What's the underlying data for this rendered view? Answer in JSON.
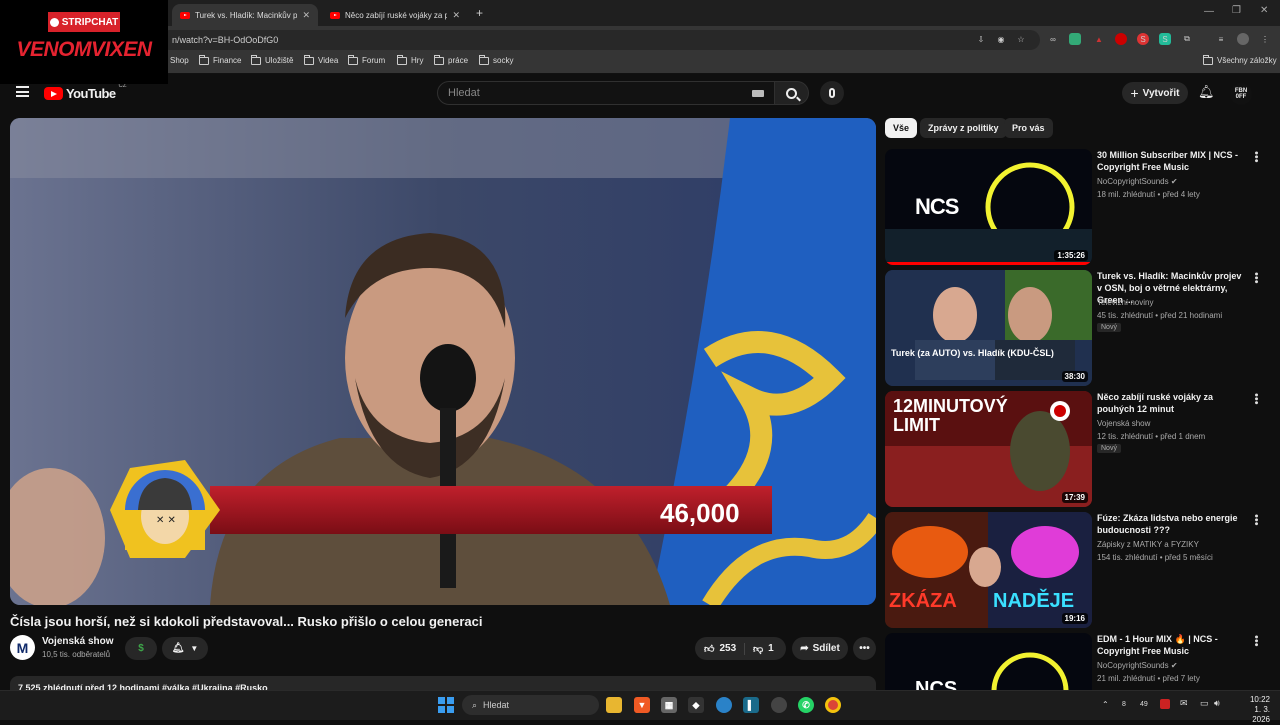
{
  "overlay": {
    "badge": "STRIPCHAT",
    "streamer": "VENOMVIXEN"
  },
  "browser": {
    "tabs": [
      {
        "title": "Turek vs. Hladík: Macinkův proj"
      },
      {
        "title": "Něco zabíjí ruské vojáky za pou"
      }
    ],
    "url": "n/watch?v=BH-OdOoDfG0",
    "bookmarks": [
      "Shop",
      "Finance",
      "Uložiště",
      "Videa",
      "Forum",
      "Hry",
      "práce",
      "socky"
    ],
    "all_bookmarks": "Všechny záložky"
  },
  "youtube": {
    "logo": "YouTube",
    "country": "CZ",
    "search_placeholder": "Hledat",
    "create_label": "Vytvořit",
    "avatar_text": "FBN 0FF"
  },
  "player": {
    "counter": "46,000"
  },
  "video": {
    "title": "Čísla jsou horší, než si kdokoli představoval... Rusko přišlo o celou generaci",
    "channel": "Vojenská show",
    "channel_initial": "M",
    "subscribers": "10,5 tis. odběratelů",
    "likes": "253",
    "dislikes": "1",
    "share_label": "Sdílet",
    "description_line": "7 525 zhlédnutí  před 12 hodinami  #válka #Ukrajina #Rusko"
  },
  "chips": [
    "Vše",
    "Zprávy z politiky",
    "Pro vás"
  ],
  "recommendations": [
    {
      "title": "30 Million Subscriber MIX | NCS - Copyright Free Music",
      "channel": "NoCopyrightSounds",
      "verified": true,
      "meta": "18 mil. zhlédnutí • před 4 lety",
      "duration": "1:35:26",
      "thumb_text": "NCS",
      "new": ""
    },
    {
      "title": "Turek vs. Hladík: Macinkův projev v OSN, boj o větrné elektrárny, Green ...",
      "channel": "Televizní noviny",
      "verified": false,
      "meta": "45 tis. zhlédnutí • před 21 hodinami",
      "duration": "38:30",
      "thumb_text": "Turek (za AUTO) vs. Hladík (KDU-ČSL)",
      "new": "Nový"
    },
    {
      "title": "Něco zabíjí ruské vojáky za pouhých 12 minut",
      "channel": "Vojenská show",
      "verified": false,
      "meta": "12 tis. zhlédnutí • před 1 dnem",
      "duration": "17:39",
      "thumb_text": "12MINUTOVÝ LIMIT",
      "new": "Nový"
    },
    {
      "title": "Fúze: Zkáza lidstva nebo energie budoucnosti ???",
      "channel": "Zápisky z MATIKY a FYZIKY",
      "verified": false,
      "meta": "154 tis. zhlédnutí • před 5 měsíci",
      "duration": "19:16",
      "thumb_text_a": "ZKÁZA",
      "thumb_text_b": "NADĚJE",
      "new": ""
    },
    {
      "title": "EDM - 1 Hour MIX 🔥 | NCS - Copyright Free Music",
      "channel": "NoCopyrightSounds",
      "verified": true,
      "meta": "21 mil. zhlédnutí • před 7 lety",
      "duration": "",
      "thumb_text": "NCS",
      "new": ""
    }
  ],
  "taskbar": {
    "search_placeholder": "Hledat",
    "time": "10:22",
    "date": "1. 3. 2026",
    "tray_nums": [
      "8",
      "49"
    ]
  },
  "colors": {
    "youtube_red": "#ff0000",
    "bg": "#0f0f0f",
    "stripchat_red": "#d8222a"
  }
}
